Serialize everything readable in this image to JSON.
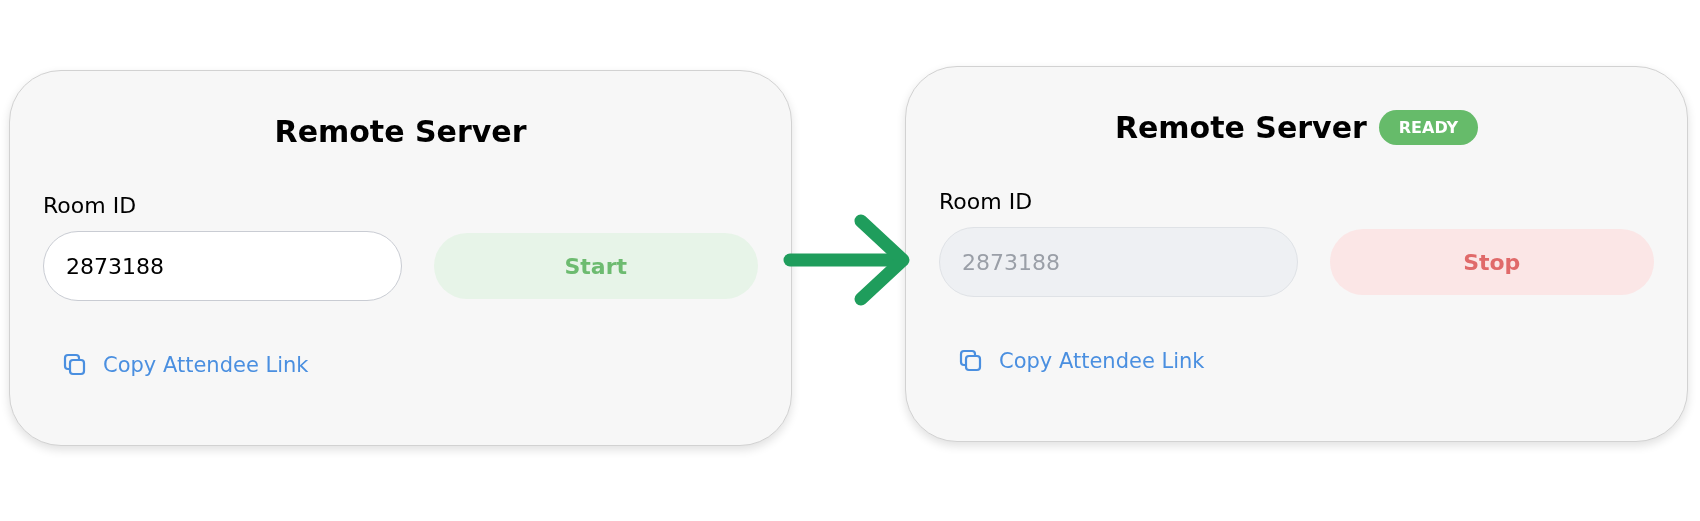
{
  "panels": [
    {
      "title": "Remote Server",
      "room_field": {
        "label": "Room ID",
        "value": "2873188",
        "disabled": false
      },
      "action_button": {
        "label": "Start",
        "kind": "start"
      },
      "copy_link": {
        "label": "Copy Attendee Link"
      }
    },
    {
      "title": "Remote Server",
      "badge": "READY",
      "room_field": {
        "label": "Room ID",
        "value": "2873188",
        "disabled": true
      },
      "action_button": {
        "label": "Stop",
        "kind": "stop"
      },
      "copy_link": {
        "label": "Copy Attendee Link"
      }
    }
  ]
}
